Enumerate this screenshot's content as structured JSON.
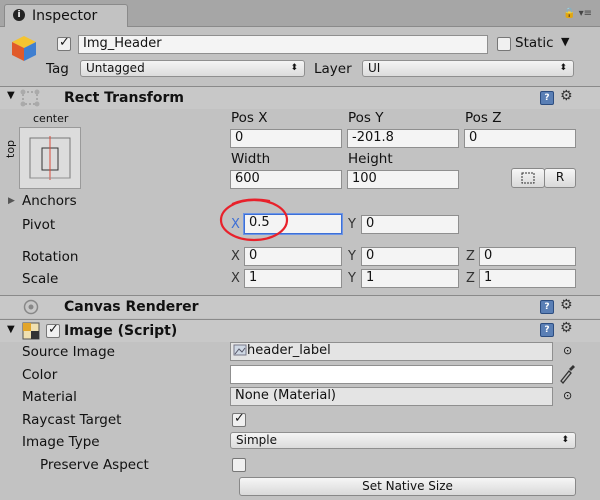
{
  "tab": {
    "title": "Inspector"
  },
  "object": {
    "name": "Img_Header",
    "static_label": "Static",
    "tag_label": "Tag",
    "tag_value": "Untagged",
    "layer_label": "Layer",
    "layer_value": "UI"
  },
  "rect_transform": {
    "title": "Rect Transform",
    "anchor_top_label": "top",
    "anchor_center_label": "center",
    "pos_x_label": "Pos X",
    "pos_y_label": "Pos Y",
    "pos_z_label": "Pos Z",
    "pos_x": "0",
    "pos_y": "-201.8",
    "pos_z": "0",
    "width_label": "Width",
    "height_label": "Height",
    "width": "600",
    "height": "100",
    "raw_button": "R",
    "anchors_label": "Anchors",
    "pivot_label": "Pivot",
    "pivot_x": "0.5",
    "pivot_y": "0",
    "rotation_label": "Rotation",
    "rot_x": "0",
    "rot_y": "0",
    "rot_z": "0",
    "scale_label": "Scale",
    "scale_x": "1",
    "scale_y": "1",
    "scale_z": "1",
    "x": "X",
    "y": "Y",
    "z": "Z"
  },
  "canvas_renderer": {
    "title": "Canvas Renderer"
  },
  "image_script": {
    "title": "Image (Script)",
    "source_image_label": "Source Image",
    "source_image_value": "header_label",
    "color_label": "Color",
    "material_label": "Material",
    "material_value": "None (Material)",
    "raycast_label": "Raycast Target",
    "image_type_label": "Image Type",
    "image_type_value": "Simple",
    "preserve_label": "Preserve Aspect",
    "native_size_button": "Set Native Size"
  },
  "colors": {
    "annotation_circle": "#e8212b",
    "focused_field_border": "#3d6fd6"
  }
}
